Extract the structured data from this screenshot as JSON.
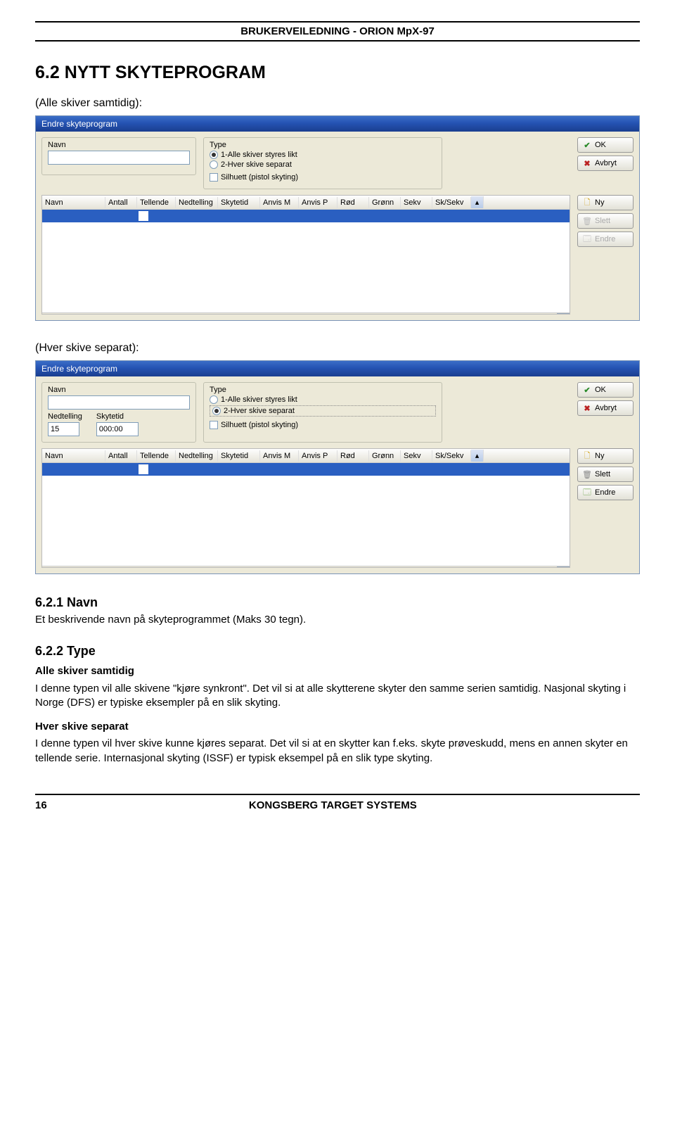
{
  "doc": {
    "header": "BRUKERVEILEDNING - ORION MpX-97",
    "section_title": "6.2 NYTT SKYTEPROGRAM",
    "caption1": "(Alle skiver samtidig):",
    "caption2": "(Hver skive separat):",
    "sub_navn_title": "6.2.1 Navn",
    "sub_navn_body": "Et beskrivende navn på skyteprogrammet (Maks 30 tegn).",
    "sub_type_title": "6.2.2 Type",
    "type_alle_heading": "Alle skiver samtidig",
    "type_alle_body": "I denne typen vil alle skivene \"kjøre synkront\". Det vil si at alle skytterene skyter den samme serien samtidig. Nasjonal skyting i Norge (DFS) er typiske eksempler på en slik skyting.",
    "type_hver_heading": "Hver skive separat",
    "type_hver_body": "I denne typen vil hver skive kunne kjøres separat. Det vil si at en skytter kan f.eks. skyte prøveskudd, mens en annen skyter en tellende serie. Internasjonal skyting (ISSF) er typisk eksempel på en slik type skyting.",
    "footer_page": "16",
    "footer_brand": "KONGSBERG TARGET SYSTEMS"
  },
  "labels": {
    "navn": "Navn",
    "type": "Type",
    "nedtelling": "Nedtelling",
    "skytetid": "Skytetid"
  },
  "dialog": {
    "title": "Endre skyteprogram",
    "type_opt1": "1-Alle skiver styres likt",
    "type_opt2": "2-Hver skive separat",
    "silhuett": "Silhuett (pistol skyting)",
    "ok": "OK",
    "avbryt": "Avbryt",
    "ny": "Ny",
    "slett": "Slett",
    "endre": "Endre"
  },
  "table": {
    "h_navn": "Navn",
    "h_antall": "Antall",
    "h_tellende": "Tellende",
    "h_nedtelling": "Nedtelling",
    "h_skytetid": "Skytetid",
    "h_anvism": "Anvis M",
    "h_anvisp": "Anvis P",
    "h_rod": "Rød",
    "h_gronn": "Grønn",
    "h_sekv": "Sekv",
    "h_sksekv": "Sk/Sekv"
  },
  "dialog2": {
    "nedtelling_val": "15",
    "skytetid_val": "000:00"
  }
}
